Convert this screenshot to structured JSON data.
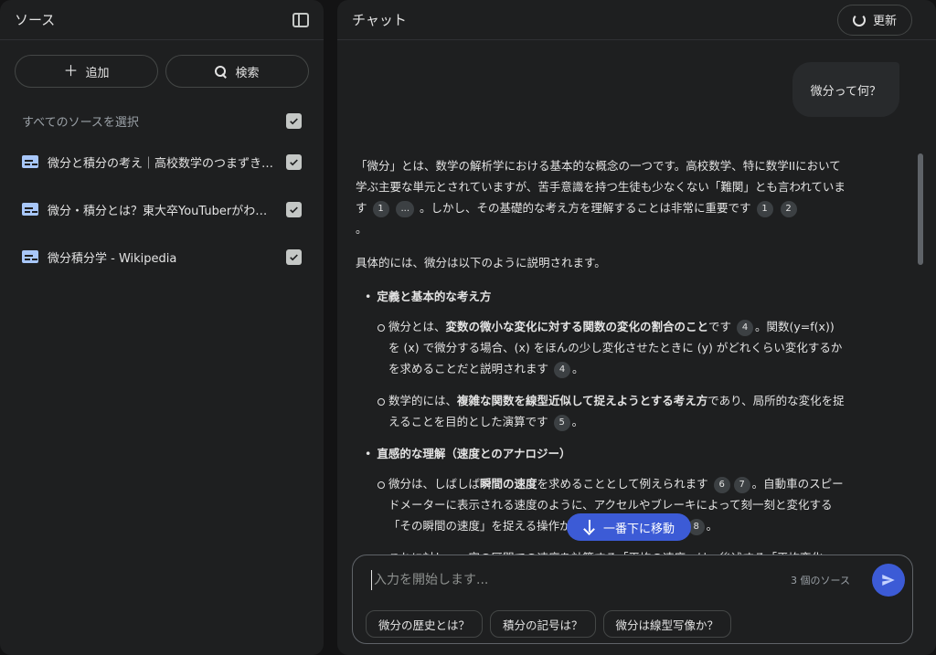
{
  "sources_panel": {
    "title": "ソース",
    "add_label": "追加",
    "search_label": "検索",
    "select_all_label": "すべてのソースを選択",
    "items": [
      {
        "label": "微分と積分の考え｜高校数学のつまずきポイント"
      },
      {
        "label": "微分・積分とは？東大卒YouTuberがわかりやすく解説"
      },
      {
        "label": "微分積分学 - Wikipedia"
      }
    ]
  },
  "chat_panel": {
    "title": "チャット",
    "refresh_label": "更新",
    "user_message": "微分って何？",
    "answer": {
      "p1_a": "「微分」とは、数学の解析学における基本的な概念の一つです。高校数学、特に数学IIにおいて学ぶ主要な単元とされていますが、苦手意識を持つ生徒も少なくない「難関」とも言われています",
      "p1_c1": "1",
      "p1_c2": "...",
      "p1_b": "。しかし、その基礎的な考え方を理解することは非常に重要です",
      "p1_c3": "1",
      "p1_c4": "2",
      "p1_end": "。",
      "p2": "具体的には、微分は以下のように説明されます。",
      "b1_title": "定義と基本的な考え方",
      "s1_a": "微分とは、",
      "s1_bold": "変数の微小な変化に対する関数の変化の割合のこと",
      "s1_b": "です",
      "s1_c1": "4",
      "s1_c": "。関数(y=f(x)) を (x) で微分する場合、(x) をほんの少し変化させたときに (y) がどれくらい変化するかを求めることだと説明されます",
      "s1_c2": "4",
      "s1_end": "。",
      "s2_a": "数学的には、",
      "s2_bold": "複雑な関数を線型近似して捉えようとする考え方",
      "s2_b": "であり、局所的な変化を捉えることを目的とした演算です",
      "s2_c1": "5",
      "s2_end": "。",
      "b2_title": "直感的な理解（速度とのアナロジー）",
      "s3_a": "微分は、しばしば",
      "s3_bold": "瞬間の速度",
      "s3_b": "を求めることとして例えられます",
      "s3_c1": "6",
      "s3_c2": "7",
      "s3_c": "。自動車のスピードメーターに表示される速度のように、アクセルやブレーキによって刻一刻と変化する「その瞬間の速度」を捉える操作が微分に相当します",
      "s3_c3": "7",
      "s3_c4": "8",
      "s3_end": "。",
      "s4": "これに対し、一定の区間での速度を計算する「平均の速度」は、後述する「平均変化"
    },
    "jump_label": "一番下に移動",
    "composer": {
      "placeholder": "入力を開始します...",
      "source_count": "3 個のソース"
    },
    "suggestions": [
      {
        "label": "微分の歴史とは？"
      },
      {
        "label": "積分の記号は？"
      },
      {
        "label": "微分は線型写像か？"
      }
    ]
  },
  "colors": {
    "background": "#131314",
    "panel": "#1e1f20",
    "accent": "#3c5bd6",
    "doc_icon": "#a8c7fa"
  }
}
